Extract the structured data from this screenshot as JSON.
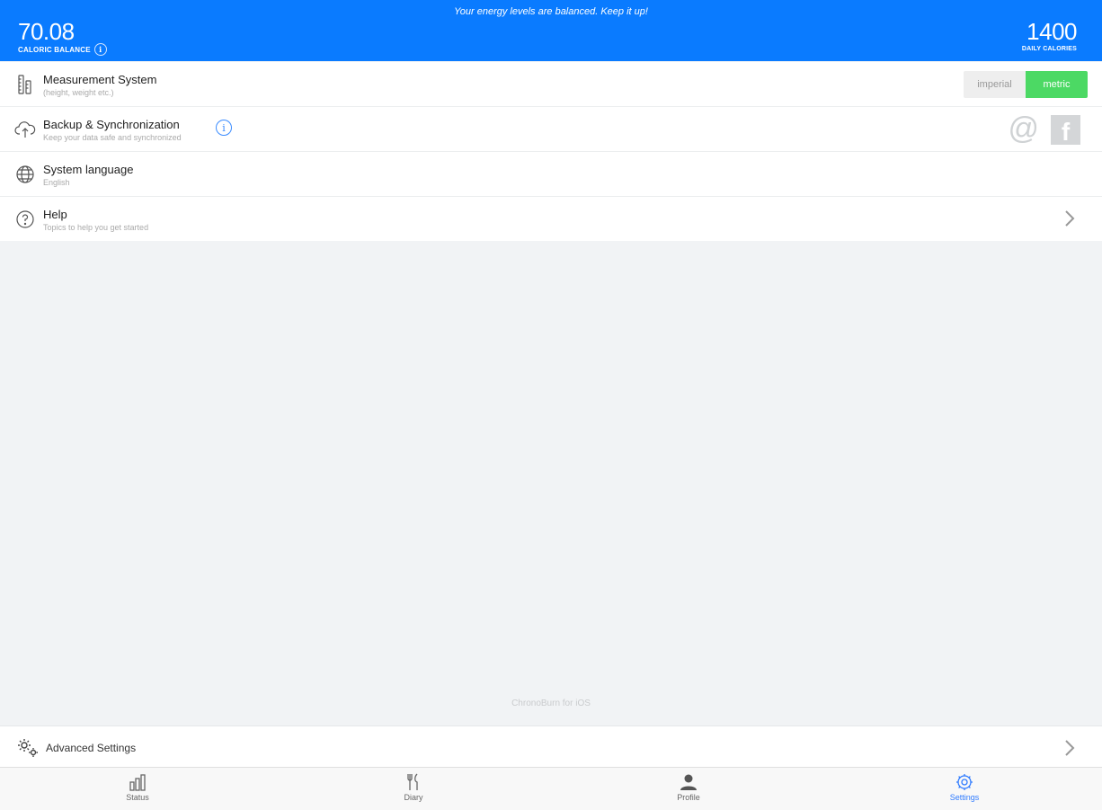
{
  "header": {
    "message": "Your energy levels are balanced. Keep it up!",
    "caloric_balance": "70.08",
    "caloric_balance_label": "CALORIC BALANCE",
    "daily_calories": "1400",
    "daily_calories_label": "DAILY CALORIES",
    "info_glyph": "i"
  },
  "settings": {
    "measurement": {
      "title": "Measurement System",
      "subtitle": "(height, weight etc.)",
      "options": [
        "imperial",
        "metric"
      ],
      "selected": "metric"
    },
    "backup": {
      "title": "Backup & Synchronization",
      "subtitle": "Keep your data safe and synchronized",
      "info_glyph": "i",
      "at_glyph": "@",
      "fb_glyph": "f"
    },
    "language": {
      "title": "System language",
      "subtitle": "English"
    },
    "help": {
      "title": "Help",
      "subtitle": "Topics to help you get started"
    }
  },
  "footer_label": "ChronoBurn for iOS",
  "advanced": {
    "title": "Advanced Settings"
  },
  "tabs": [
    {
      "label": "Status",
      "icon": "bar-chart-icon"
    },
    {
      "label": "Diary",
      "icon": "fork-knife-icon"
    },
    {
      "label": "Profile",
      "icon": "person-icon"
    },
    {
      "label": "Settings",
      "icon": "gear-icon"
    }
  ],
  "colors": {
    "header_bg": "#0a7bff",
    "toggle_on": "#4cd964",
    "active_tab": "#2f7bff"
  }
}
